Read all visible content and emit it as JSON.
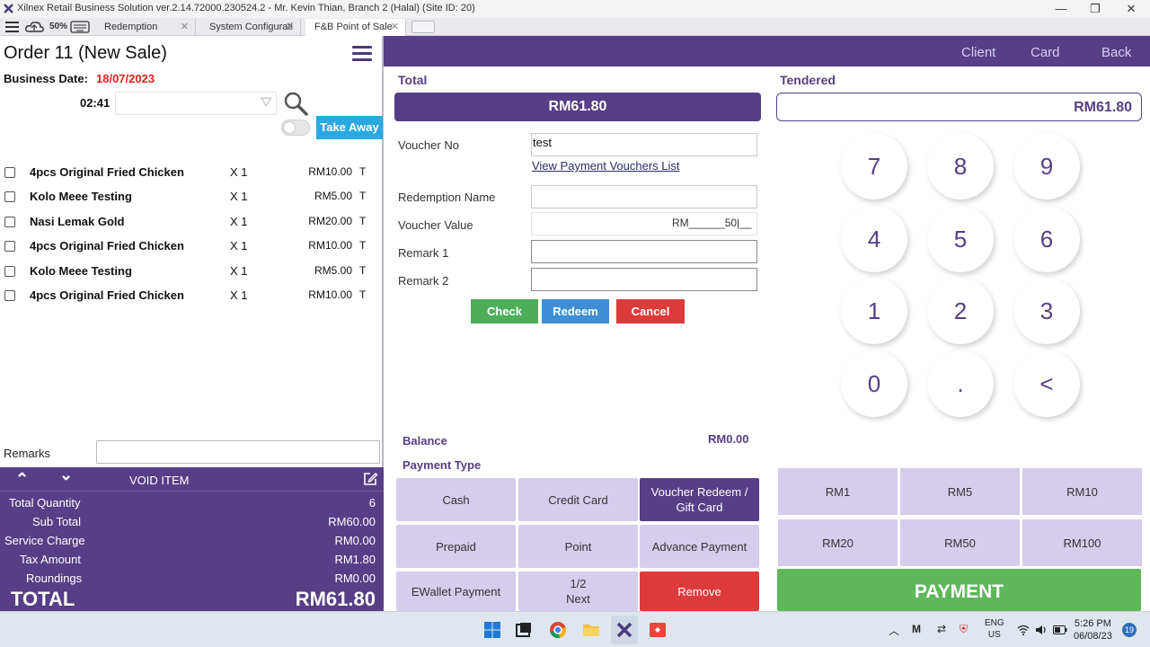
{
  "window": {
    "title": "Xilnex Retail Business Solution ver.2.14.72000.230524.2 - Mr. Kevin Thian, Branch 2 (Halal) (Site ID: 20)",
    "minimize": "—",
    "maximize": "❐",
    "close": "✕"
  },
  "toolbar": {
    "battery_label": "50%"
  },
  "tabs": [
    {
      "label": "Redemption"
    },
    {
      "label": "System Configurati"
    },
    {
      "label": "F&B Point of Sale"
    }
  ],
  "order": {
    "title": "Order  11 (New Sale)",
    "business_date_label": "Business Date:",
    "business_date": "18/07/2023",
    "time": "02:41",
    "take_away": "Take Away",
    "items": [
      {
        "name": "4pcs Original Fried Chicken",
        "qty": "X 1",
        "price": "RM10.00",
        "tax": "T"
      },
      {
        "name": "Kolo Meee Testing",
        "qty": "X 1",
        "price": "RM5.00",
        "tax": "T"
      },
      {
        "name": "Nasi Lemak Gold",
        "qty": "X 1",
        "price": "RM20.00",
        "tax": "T"
      },
      {
        "name": "4pcs Original Fried Chicken",
        "qty": "X 1",
        "price": "RM10.00",
        "tax": "T"
      },
      {
        "name": "Kolo Meee Testing",
        "qty": "X 1",
        "price": "RM5.00",
        "tax": "T"
      },
      {
        "name": "4pcs Original Fried Chicken",
        "qty": "X 1",
        "price": "RM10.00",
        "tax": "T"
      }
    ],
    "remarks_label": "Remarks"
  },
  "summary": {
    "void_label": "VOID ITEM",
    "up": "⌃",
    "down": "⌄",
    "rows": [
      {
        "label": "Total Quantity",
        "value": "6"
      },
      {
        "label": "Sub Total",
        "value": "RM60.00"
      },
      {
        "label": "Service Charge",
        "value": "RM0.00"
      },
      {
        "label": "Tax Amount",
        "value": "RM1.80"
      },
      {
        "label": "Roundings",
        "value": "RM0.00"
      }
    ],
    "total_label": "TOTAL",
    "total_value": "RM61.80"
  },
  "header": {
    "client": "Client",
    "card": "Card",
    "back": "Back"
  },
  "payment": {
    "total_label": "Total",
    "total_value": "RM61.80",
    "tendered_label": "Tendered",
    "tendered_value": "RM61.80",
    "voucher_no_label": "Voucher No",
    "voucher_no_value": "test",
    "voucher_list_link": "View Payment Vouchers List",
    "redemption_name_label": "Redemption Name",
    "voucher_value_label": "Voucher Value",
    "voucher_value_display": "RM______50|__",
    "remark1_label": "Remark 1",
    "remark2_label": "Remark 2",
    "check": "Check",
    "redeem": "Redeem",
    "cancel": "Cancel",
    "balance_label": "Balance",
    "balance_value": "RM0.00",
    "payment_type_label": "Payment Type",
    "types": [
      {
        "label": "Cash"
      },
      {
        "label": "Credit Card"
      },
      {
        "label": "Voucher Redeem / Gift Card"
      },
      {
        "label": "Prepaid"
      },
      {
        "label": "Point"
      },
      {
        "label": "Advance Payment"
      },
      {
        "label": "EWallet Payment"
      },
      {
        "label": "1/2\nNext"
      },
      {
        "label": "Remove"
      }
    ],
    "quick": [
      "RM1",
      "RM5",
      "RM10",
      "RM20",
      "RM50",
      "RM100"
    ],
    "payment_button": "PAYMENT"
  },
  "numpad": [
    "7",
    "8",
    "9",
    "4",
    "5",
    "6",
    "1",
    "2",
    "3",
    "0",
    ".",
    "<"
  ],
  "taskbar": {
    "lang_top": "ENG",
    "lang_bottom": "US",
    "time": "5:26 PM",
    "date": "06/08/23",
    "notifications": "19"
  },
  "colors": {
    "primary": "#563f86",
    "accent_blue": "#29a9e0",
    "check_green": "#4cae58",
    "redeem_blue": "#3f8ed4",
    "danger_red": "#dd3b3b",
    "payment_green": "#5eb85a",
    "date_red": "#e02020"
  }
}
